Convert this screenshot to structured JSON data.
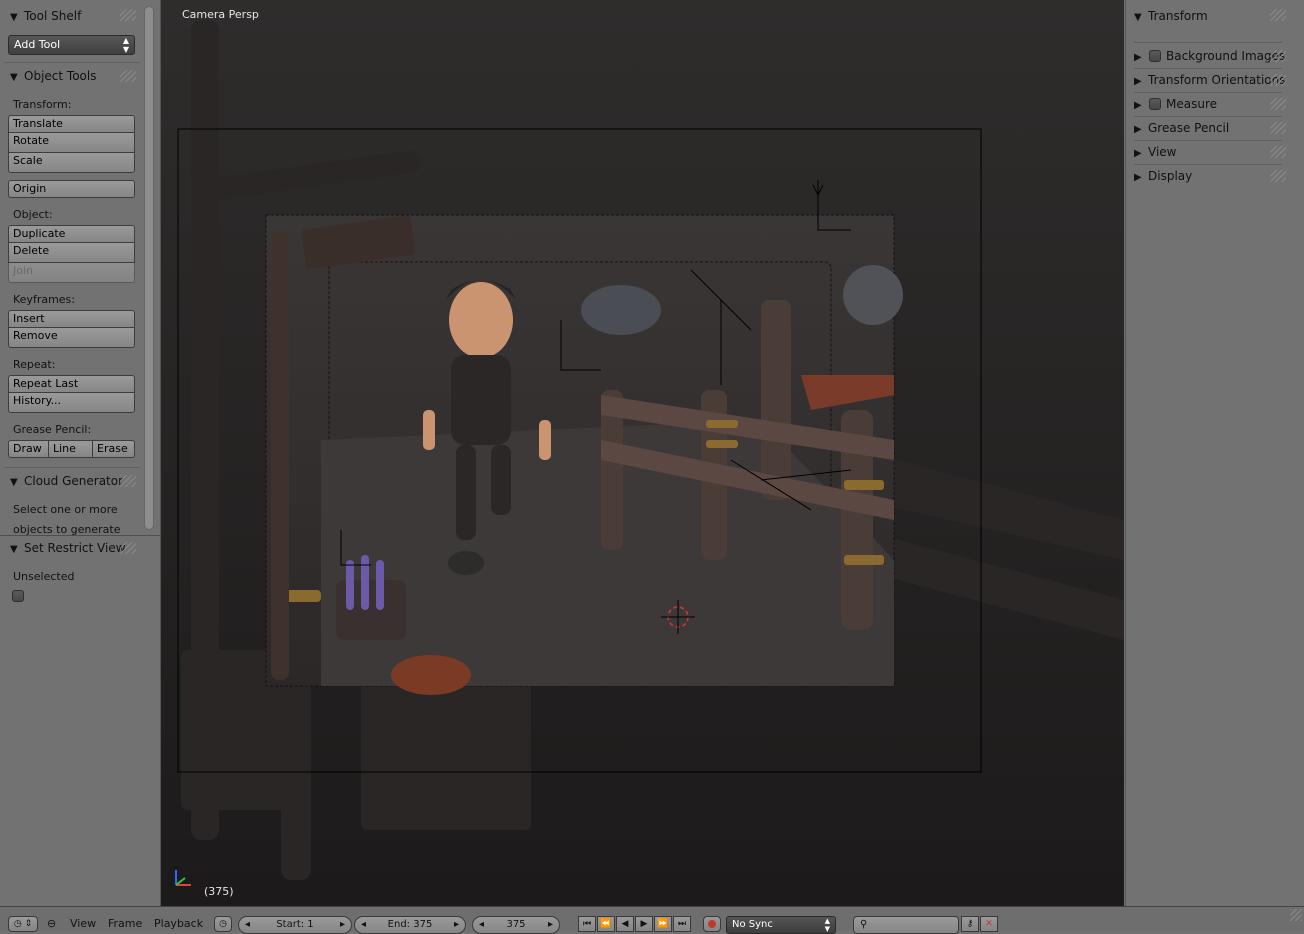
{
  "tool_shelf": {
    "header": "Tool Shelf",
    "add_tool_dropdown": "Add Tool",
    "object_tools": {
      "header": "Object Tools",
      "transform_label": "Transform:",
      "translate": "Translate",
      "rotate": "Rotate",
      "scale": "Scale",
      "origin": "Origin",
      "object_label": "Object:",
      "duplicate": "Duplicate",
      "delete": "Delete",
      "join": "Join",
      "keyframes_label": "Keyframes:",
      "insert": "Insert",
      "remove": "Remove",
      "repeat_label": "Repeat:",
      "repeat_last": "Repeat Last",
      "history": "History...",
      "grease_pencil_label": "Grease Pencil:",
      "draw": "Draw",
      "line": "Line",
      "erase": "Erase"
    },
    "cloud_generator": {
      "header": "Cloud Generator",
      "text_line1": "Select one or more",
      "text_line2": "objects to generate"
    },
    "set_restrict_view": {
      "header": "Set Restrict View",
      "unselected_label": "Unselected"
    }
  },
  "viewport": {
    "view_name": "Camera Persp",
    "frame_indicator": "(375)"
  },
  "properties": {
    "transform": "Transform",
    "background_images": "Background Images",
    "transform_orientations": "Transform Orientations",
    "measure": "Measure",
    "grease_pencil": "Grease Pencil",
    "view": "View",
    "display": "Display"
  },
  "timeline": {
    "menu_view": "View",
    "menu_frame": "Frame",
    "menu_playback": "Playback",
    "start": "Start: 1",
    "end": "End: 375",
    "current_frame": "375",
    "sync": "No Sync"
  },
  "colors": {
    "panel_bg": "#727272",
    "viewport_bg": "#1f1e1e",
    "record_button": "#c0392b"
  }
}
